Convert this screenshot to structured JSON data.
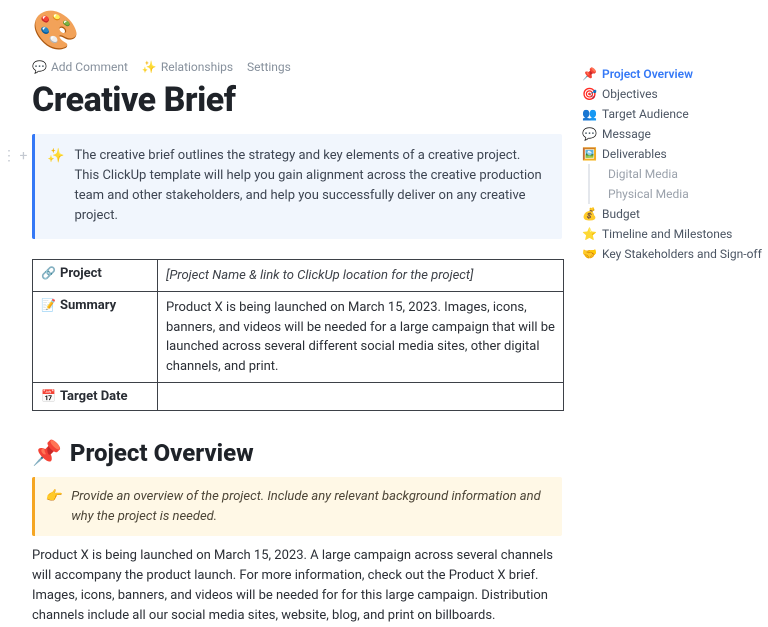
{
  "header": {
    "palette_emoji": "🎨",
    "toolbar": {
      "add_comment": "Add Comment",
      "relationships": "Relationships",
      "settings": "Settings"
    },
    "title": "Creative Brief"
  },
  "callout": {
    "icon": "✨",
    "text": "The creative brief outlines the strategy and key elements of a creative project. This ClickUp template will help you gain alignment across the creative production team and other stakeholders, and help you successfully deliver on any creative project."
  },
  "table": {
    "project_label": "Project",
    "project_icon": "🔗",
    "project_value": "[Project Name & link to ClickUp location for the project]",
    "summary_label": "Summary",
    "summary_icon": "📝",
    "summary_value": "Product X is being launched on March 15, 2023. Images, icons, banners, and videos will be needed for a large campaign that will be launched across several different social media sites, other digital channels, and print.",
    "target_label": "Target Date",
    "target_icon": "📅",
    "target_value": ""
  },
  "section": {
    "icon": "📌",
    "title": "Project Overview",
    "tip_icon": "👉",
    "tip_text": "Provide an overview of the project. Include any relevant background information and why the project is needed.",
    "body": "Product X is being launched on March 15, 2023. A large campaign across several channels will accompany the product launch. For more information, check out the Product X brief. Images, icons, banners, and videos will be needed for for this large campaign. Distribution channels include all our social media sites, website, blog, and print on billboards."
  },
  "nav": {
    "items": [
      {
        "icon": "📌",
        "label": "Project Overview",
        "active": true
      },
      {
        "icon": "🎯",
        "label": "Objectives"
      },
      {
        "icon": "👥",
        "label": "Target Audience"
      },
      {
        "icon": "💬",
        "label": "Message"
      },
      {
        "icon": "🖼️",
        "label": "Deliverables"
      },
      {
        "icon": "",
        "label": "Digital Media",
        "sub": true
      },
      {
        "icon": "",
        "label": "Physical Media",
        "sub": true
      },
      {
        "icon": "💰",
        "label": "Budget"
      },
      {
        "icon": "⭐",
        "label": "Timeline and Milestones"
      },
      {
        "icon": "🤝",
        "label": "Key Stakeholders and Sign-off"
      }
    ]
  }
}
